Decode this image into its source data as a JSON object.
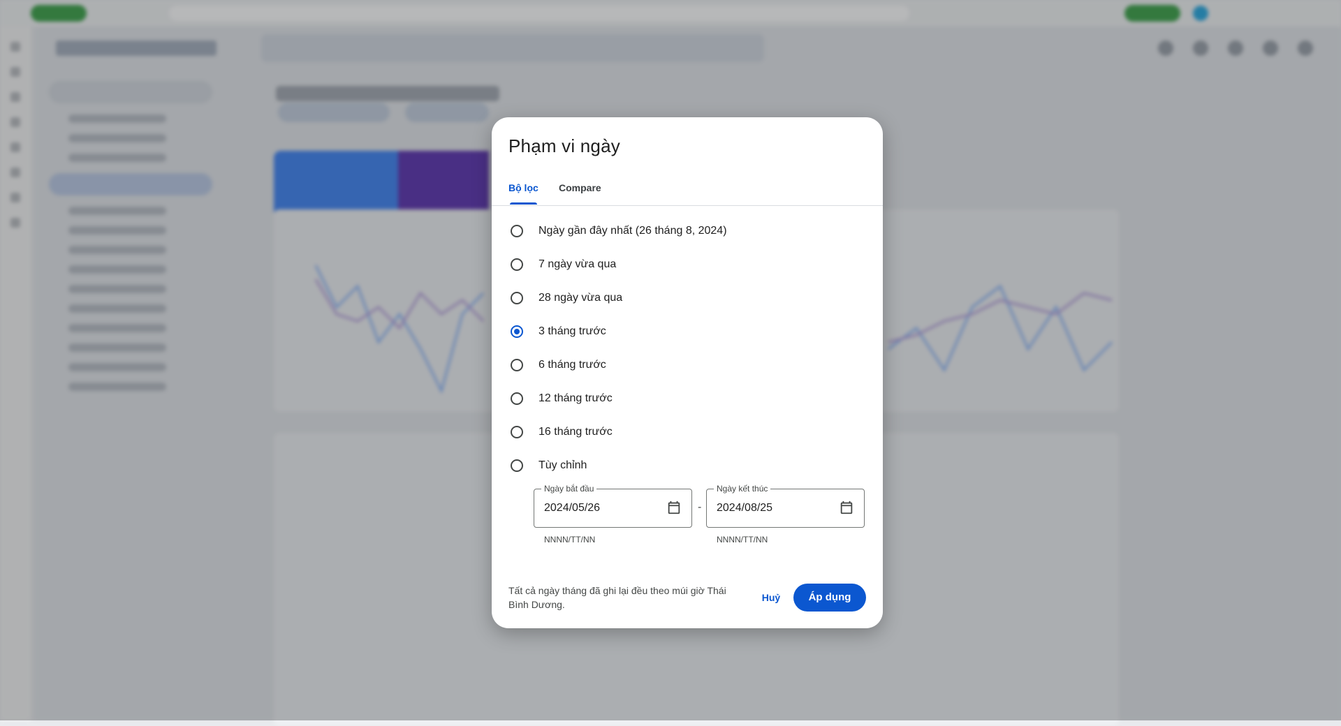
{
  "dialog": {
    "title": "Phạm vi ngày",
    "tabs": [
      {
        "label": "Bộ lọc",
        "active": true
      },
      {
        "label": "Compare",
        "active": false
      }
    ],
    "options": [
      {
        "label": "Ngày gần đây nhất (26 tháng 8, 2024)",
        "checked": false
      },
      {
        "label": "7 ngày vừa qua",
        "checked": false
      },
      {
        "label": "28 ngày vừa qua",
        "checked": false
      },
      {
        "label": "3 tháng trước",
        "checked": true
      },
      {
        "label": "6 tháng trước",
        "checked": false
      },
      {
        "label": "12 tháng trước",
        "checked": false
      },
      {
        "label": "16 tháng trước",
        "checked": false
      },
      {
        "label": "Tùy chỉnh",
        "checked": false
      }
    ],
    "start_date": {
      "label": "Ngày bắt đầu",
      "value": "2024/05/26",
      "hint": "NNNN/TT/NN"
    },
    "date_separator": "-",
    "end_date": {
      "label": "Ngày kết thúc",
      "value": "2024/08/25",
      "hint": "NNNN/TT/NN"
    },
    "timezone_note": "Tất cả ngày tháng đã ghi lại đều theo múi giờ Thái Bình Dương.",
    "cancel_label": "Huỷ",
    "apply_label": "Áp dụng"
  },
  "colors": {
    "accent": "#0b57d0",
    "metric_clicks": "#4285f4",
    "metric_impressions": "#5e35b1",
    "overlay": "rgba(32,33,36,0.32)"
  }
}
